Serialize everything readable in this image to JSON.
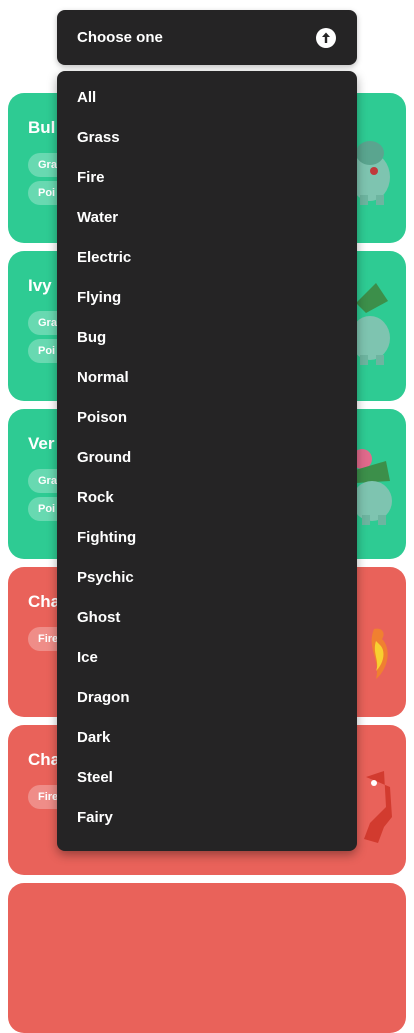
{
  "select": {
    "label": "Choose one",
    "icon": "arrow-up-circle-icon"
  },
  "dropdown": {
    "options": [
      "All",
      "Grass",
      "Fire",
      "Water",
      "Electric",
      "Flying",
      "Bug",
      "Normal",
      "Poison",
      "Ground",
      "Rock",
      "Fighting",
      "Psychic",
      "Ghost",
      "Ice",
      "Dragon",
      "Dark",
      "Steel",
      "Fairy"
    ]
  },
  "cards": [
    {
      "name": "Bul",
      "types": [
        "Gra",
        "Poi"
      ],
      "color": "#2ecb93"
    },
    {
      "name": "Ivy",
      "types": [
        "Gra",
        "Poi"
      ],
      "color": "#2ecb93"
    },
    {
      "name": "Ver",
      "types": [
        "Gra",
        "Poi"
      ],
      "color": "#2ecb93"
    },
    {
      "name": "Cha",
      "types": [
        "Fire"
      ],
      "color": "#e9625a"
    },
    {
      "name": "Cha",
      "types": [
        "Fire"
      ],
      "color": "#e9625a"
    }
  ],
  "colors": {
    "grass": "#2ecb93",
    "fire": "#e9625a",
    "dropdown_bg": "#252425"
  }
}
